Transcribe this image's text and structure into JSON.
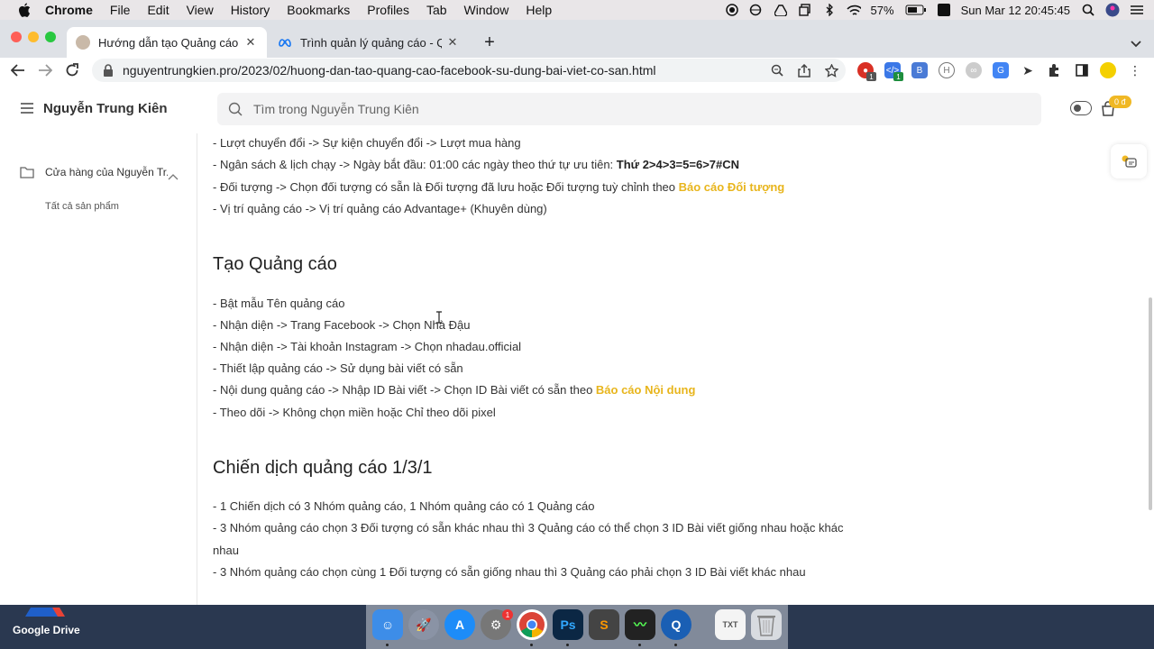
{
  "menubar": {
    "app": "Chrome",
    "items": [
      "File",
      "Edit",
      "View",
      "History",
      "Bookmarks",
      "Profiles",
      "Tab",
      "Window",
      "Help"
    ],
    "battery": "57%",
    "datetime": "Sun Mar 12  20:45:45"
  },
  "tabs": [
    {
      "title": "Hướng dẫn tạo Quảng cáo Facebook sử dụng bài viết có sẵn",
      "favicon": "avatar-favicon"
    },
    {
      "title": "Trình quản lý quảng cáo - Quảng cáo",
      "favicon": "meta-favicon"
    }
  ],
  "toolbar": {
    "url": "nguyentrungkien.pro/2023/02/huong-dan-tao-quang-cao-facebook-su-dung-bai-viet-co-san.html",
    "ext_badge_1": "1",
    "ext_badge_2": "1"
  },
  "site": {
    "name": "Nguyễn Trung Kiên",
    "search_placeholder": "Tìm trong Nguyễn Trung Kiên",
    "cart_badge": "0 đ"
  },
  "sidebar": {
    "store_label": "Cửa hàng của Nguyễn Tr...",
    "sub_label": "Tất cả sản phẩm"
  },
  "article": {
    "top_lines": {
      "l1": "- Lượt chuyển đổi -> Sự kiện chuyển đổi -> Lượt mua hàng",
      "l2_prefix": "- Ngân sách & lịch chạy -> Ngày bắt đầu: 01:00 các ngày theo thứ tự ưu tiên: ",
      "l2_bold": "Thứ 2>4>3=5=6>7#CN",
      "l3_prefix": "- Đối tượng -> Chọn đối tượng có sẵn là Đối tượng đã lưu hoặc Đối tượng tuỳ chỉnh theo ",
      "l3_link": "Báo cáo Đối tượng",
      "l4": "- Vị trí quảng cáo -> Vị trí quảng cáo Advantage+ (Khuyên dùng)"
    },
    "section1": {
      "heading": "Tạo Quảng cáo",
      "l1": "- Bật mẫu Tên quảng cáo",
      "l2": "- Nhận diện -> Trang Facebook -> Chọn Nhà Đậu",
      "l3": "- Nhận diện -> Tài khoản Instagram -> Chọn nhadau.official",
      "l4": "- Thiết lập quảng cáo -> Sử dụng bài viết có sẵn",
      "l5_prefix": "- Nội dung quảng cáo -> Nhập ID Bài viết -> Chọn ID Bài viết có sẵn theo ",
      "l5_link": "Báo cáo Nội dung",
      "l6": "- Theo dõi -> Không chọn miền hoặc Chỉ theo dõi pixel"
    },
    "section2": {
      "heading": "Chiến dịch quảng cáo 1/3/1",
      "l1": "- 1 Chiến dịch có 3 Nhóm quảng cáo, 1 Nhóm quảng cáo có 1 Quảng cáo",
      "l2a": "- 3 Nhóm quảng cáo chọn 3 Đối tượng có sẵn khác nhau thì 3 Quảng cáo có thể chọn 3 ID Bài viết giống nhau hoặc khác",
      "l2b": "nhau",
      "l3": "- 3 Nhóm quảng cáo chọn cùng 1 Đối tượng có sẵn giống nhau thì 3 Quảng cáo phải chọn 3 ID Bài viết khác nhau"
    }
  },
  "desktop": {
    "drive_label": "Google Drive",
    "dock_badge": "1"
  },
  "colors": {
    "accent": "#e8b51c",
    "tabstrip": "#dee1e6"
  }
}
